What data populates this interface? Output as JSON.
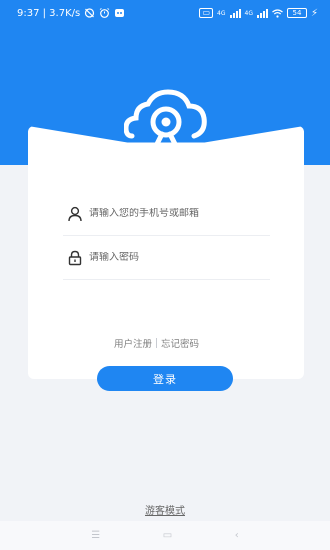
{
  "status_bar": {
    "time_speed": "9:37 | 3.7K/s",
    "net_left": "4G",
    "net_right": "4G",
    "battery": "54"
  },
  "login_card": {
    "account_placeholder": "请输入您的手机号或邮箱",
    "password_placeholder": "请输入密码",
    "register_label": "用户注册",
    "forgot_label": "忘记密码"
  },
  "login_button_label": "登录",
  "guest_mode_label": "游客模式",
  "colors": {
    "primary": "#1f86f2",
    "background": "#f1f3f7"
  },
  "icons": [
    "camera-cloud-logo",
    "user-icon",
    "lock-icon",
    "menu-icon",
    "home-icon",
    "back-icon"
  ]
}
